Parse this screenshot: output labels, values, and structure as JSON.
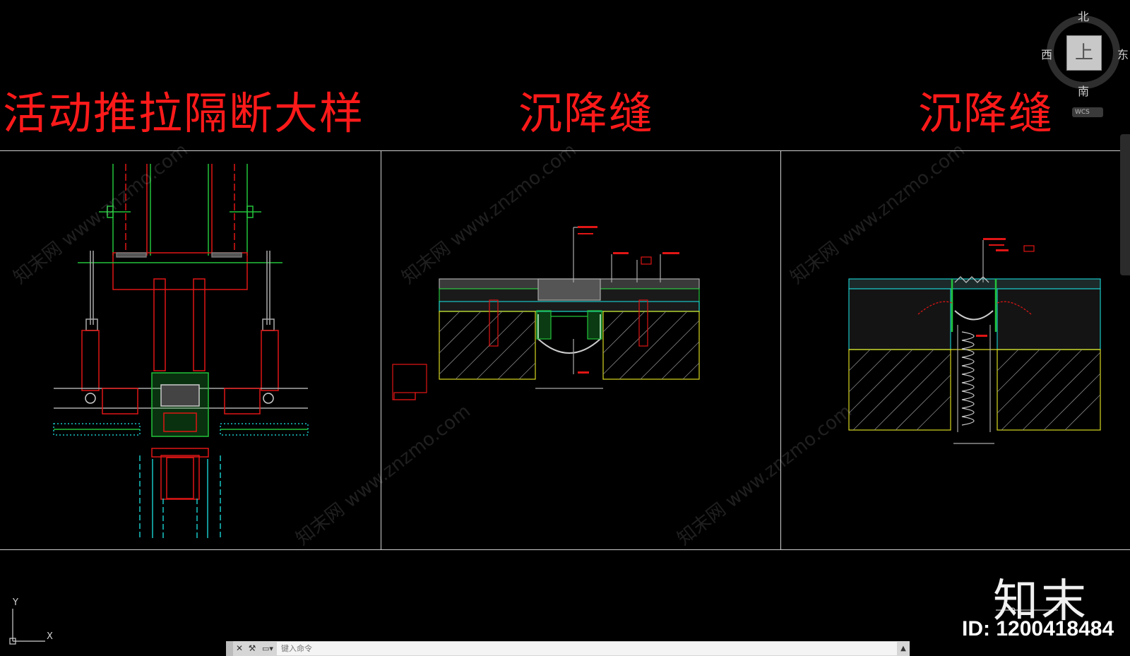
{
  "titles": {
    "left": "活动推拉隔断大样",
    "middle": "沉降缝",
    "right": "沉降缝"
  },
  "viewcube": {
    "north": "北",
    "south": "南",
    "west": "西",
    "east": "东",
    "face": "上",
    "wcs": "WCS"
  },
  "ucs": {
    "x": "X",
    "y": "Y"
  },
  "watermark": {
    "brand": "知末",
    "id": "ID: 1200418484",
    "text": "知末网 www.znzmo.com"
  },
  "command_line": {
    "placeholder": "键入命令",
    "close_icon": "close-icon",
    "wrench_icon": "wrench-icon"
  },
  "colors": {
    "background": "#000000",
    "title": "#ff1a1a",
    "green": "#22c33a",
    "red": "#e01515",
    "cyan": "#19c6c6",
    "yellow": "#d8d820"
  }
}
